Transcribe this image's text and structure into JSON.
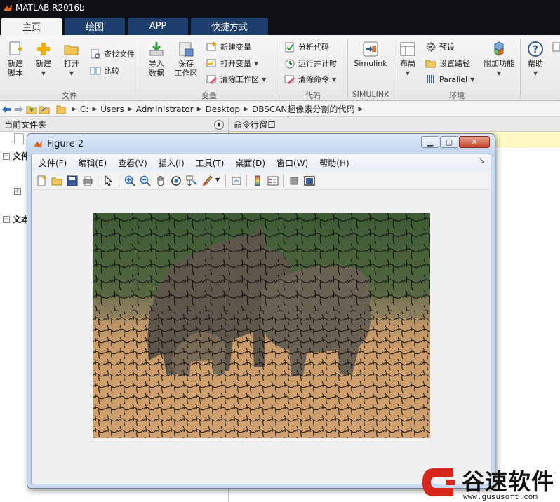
{
  "app": {
    "title": "MATLAB R2016b"
  },
  "tabs": [
    {
      "label": "主页",
      "active": true
    },
    {
      "label": "绘图",
      "active": false
    },
    {
      "label": "APP",
      "active": false
    },
    {
      "label": "快捷方式",
      "active": false
    }
  ],
  "ribbon": {
    "file": {
      "new_script": "新建\n脚本",
      "new": "新建",
      "open": "打开",
      "find_files": "查找文件",
      "compare": "比较",
      "group": "文件"
    },
    "variable": {
      "import_data": "导入\n数据",
      "save_workspace": "保存\n工作区",
      "new_variable": "新建变量",
      "open_variable": "打开变量",
      "clear_workspace": "清除工作区",
      "group": "变量"
    },
    "code": {
      "analyze_code": "分析代码",
      "run_and_time": "运行并计时",
      "clear_commands": "清除命令",
      "group": "代码"
    },
    "simulink": {
      "label": "Simulink",
      "group": "SIMULINK"
    },
    "environment": {
      "layout": "布局",
      "preferences": "预设",
      "set_path": "设置路径",
      "parallel": "Parallel",
      "add_ons": "附加功能",
      "group": "环境"
    },
    "help": {
      "label": "帮助"
    }
  },
  "address": {
    "crumbs": [
      "C:",
      "Users",
      "Administrator",
      "Desktop",
      "DBSCAN超像素分割的代码"
    ]
  },
  "left_pane": {
    "header": "当前文件夹",
    "tree_items": [
      "文件",
      "文本"
    ]
  },
  "cmd_pane": {
    "header": "命令行窗口"
  },
  "figure": {
    "title": "Figure 2",
    "menus": [
      "文件(F)",
      "编辑(E)",
      "查看(V)",
      "插入(I)",
      "工具(T)",
      "桌面(D)",
      "窗口(W)",
      "帮助(H)"
    ],
    "toolbar_icons": [
      "new-figure-icon",
      "open-icon",
      "save-icon",
      "print-icon",
      "pointer-icon",
      "zoom-in-icon",
      "zoom-out-icon",
      "pan-icon",
      "rotate-icon",
      "data-cursor-icon",
      "brush-icon",
      "link-icon",
      "colorbar-icon",
      "legend-icon",
      "hide-plot-tools-icon",
      "show-plot-tools-icon"
    ],
    "image_description": "superpixel-segmented-elephants"
  },
  "watermark": {
    "text": "谷速软件",
    "url": "www.gususoft.com",
    "accent": "#d9261c"
  },
  "colors": {
    "tab_bg": "#1e3f6e",
    "titlebar": "#0f0f14",
    "figure_frame": "#c9daf0"
  }
}
